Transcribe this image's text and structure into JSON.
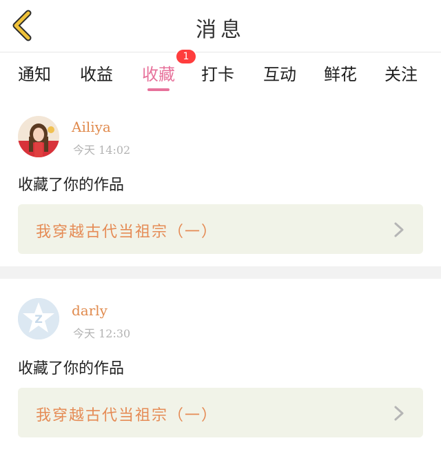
{
  "header": {
    "title": "消息",
    "back_icon": "chevron-left-icon",
    "accent": "#f0c23a"
  },
  "tabs": [
    {
      "label": "通知"
    },
    {
      "label": "收益"
    },
    {
      "label": "收藏",
      "active": true,
      "badge": "1"
    },
    {
      "label": "打卡"
    },
    {
      "label": "互动"
    },
    {
      "label": "鲜花"
    },
    {
      "label": "关注"
    }
  ],
  "colors": {
    "active_tab": "#e7729b",
    "badge": "#ff3d3d",
    "username": "#e08a4d",
    "work_title": "#e58b55",
    "work_box_bg": "#f1f3e8"
  },
  "messages": [
    {
      "username": "Ailiya",
      "time": "今天 14:02",
      "action": "收藏了你的作品",
      "work_title": "我穿越古代当祖宗（一）",
      "avatar": "photo-avatar"
    },
    {
      "username": "darly",
      "time": "今天 12:30",
      "action": "收藏了你的作品",
      "work_title": "我穿越古代当祖宗（一）",
      "avatar": "default-star-avatar"
    }
  ]
}
